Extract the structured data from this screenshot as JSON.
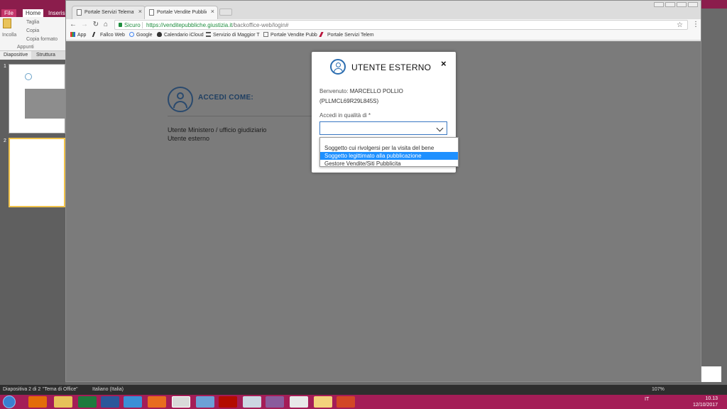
{
  "ppt": {
    "tabs": [
      "File",
      "Home",
      "Inserisci"
    ],
    "ribbon": {
      "paste": "Incolla",
      "cut": "Taglia",
      "copy": "Copia",
      "format_copy": "Copia formato",
      "clipboard": "Appunti"
    },
    "panel_tabs": [
      "Diapositive",
      "Struttura"
    ],
    "slide_numbers": [
      "1",
      "2"
    ],
    "status": {
      "slide": "Diapositiva 2 di 2",
      "theme": "\"Tema di Office\"",
      "language": "Italiano (Italia)",
      "zoom": "107%"
    }
  },
  "browser": {
    "tabs": [
      {
        "title": "Portale Servizi Telematici",
        "close": "×"
      },
      {
        "title": "Portale Vendite Pubbliche",
        "close": "×"
      }
    ],
    "address": {
      "secure_label": "Sicuro",
      "url_host": "https://venditepubbliche.giustizia.it",
      "url_path": "/backoffice-web/login#"
    },
    "bookmarks": [
      {
        "label": "App"
      },
      {
        "label": "Fallco Web"
      },
      {
        "label": "Google"
      },
      {
        "label": "Calendario iCloud"
      },
      {
        "label": "Servizio di Maggior T"
      },
      {
        "label": "Portale Vendite Pubb"
      },
      {
        "label": "Portale Servizi Telem"
      }
    ]
  },
  "page": {
    "login_title": "ACCEDI COME:",
    "options": [
      "Utente Ministero / ufficio giudiziario",
      "Utente esterno"
    ]
  },
  "modal": {
    "title": "UTENTE ESTERNO",
    "close": "×",
    "welcome_label": "Benvenuto:",
    "welcome_name": "MARCELLO POLLIO",
    "fiscal_code": "(PLLMCL69R29L845S)",
    "role_label": "Accedi in qualità di *",
    "dropdown_options": [
      "Soggetto cui rivolgersi per la visita del bene",
      "Soggetto legittimato alla pubblicazione",
      "Gestore Vendite/Siti Pubblicita"
    ],
    "highlighted_option": "Soggetto legittimato alla pubblicazione"
  },
  "taskbar": {
    "language": "IT",
    "time": "10.13",
    "date": "12/10/2017"
  },
  "colors": {
    "ppt_accent": "#8b1d4c",
    "taskbar": "#a41d57",
    "secure_green": "#1e8e3e",
    "select_border": "#3a78c2",
    "option_highlight": "#1e90ff",
    "login_blue": "#1f3f62"
  }
}
